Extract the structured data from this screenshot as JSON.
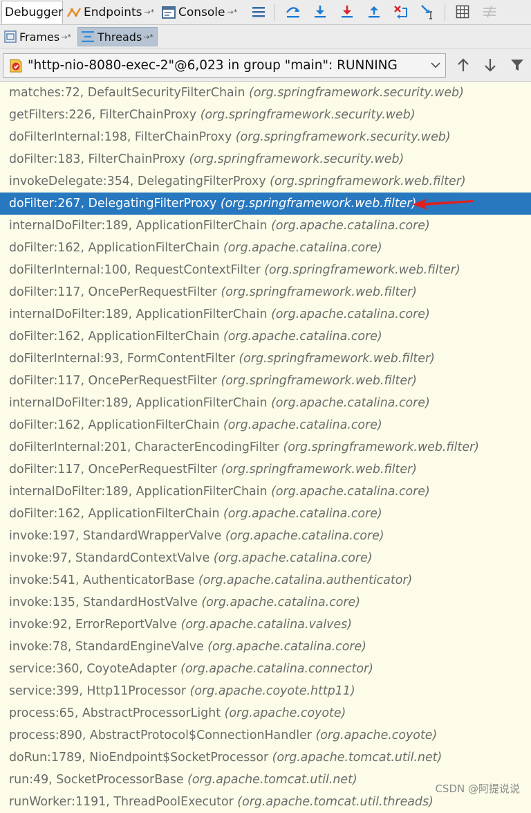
{
  "toolbar": {
    "tabs": [
      {
        "label": "Debugger"
      },
      {
        "label": "Endpoints"
      },
      {
        "label": "Console"
      }
    ],
    "pin_glyph": "→*"
  },
  "subtabs": [
    {
      "label": "Frames"
    },
    {
      "label": "Threads"
    }
  ],
  "thread_selector": {
    "value": "\"http-nio-8080-exec-2\"@6,023 in group \"main\": RUNNING"
  },
  "frames": [
    {
      "method": "matches:72, DefaultSecurityFilterChain",
      "package": "(org.springframework.security.web)"
    },
    {
      "method": "getFilters:226, FilterChainProxy",
      "package": "(org.springframework.security.web)"
    },
    {
      "method": "doFilterInternal:198, FilterChainProxy",
      "package": "(org.springframework.security.web)"
    },
    {
      "method": "doFilter:183, FilterChainProxy",
      "package": "(org.springframework.security.web)"
    },
    {
      "method": "invokeDelegate:354, DelegatingFilterProxy",
      "package": "(org.springframework.web.filter)"
    },
    {
      "method": "doFilter:267, DelegatingFilterProxy",
      "package": "(org.springframework.web.filter)",
      "selected": true
    },
    {
      "method": "internalDoFilter:189, ApplicationFilterChain",
      "package": "(org.apache.catalina.core)"
    },
    {
      "method": "doFilter:162, ApplicationFilterChain",
      "package": "(org.apache.catalina.core)"
    },
    {
      "method": "doFilterInternal:100, RequestContextFilter",
      "package": "(org.springframework.web.filter)"
    },
    {
      "method": "doFilter:117, OncePerRequestFilter",
      "package": "(org.springframework.web.filter)"
    },
    {
      "method": "internalDoFilter:189, ApplicationFilterChain",
      "package": "(org.apache.catalina.core)"
    },
    {
      "method": "doFilter:162, ApplicationFilterChain",
      "package": "(org.apache.catalina.core)"
    },
    {
      "method": "doFilterInternal:93, FormContentFilter",
      "package": "(org.springframework.web.filter)"
    },
    {
      "method": "doFilter:117, OncePerRequestFilter",
      "package": "(org.springframework.web.filter)"
    },
    {
      "method": "internalDoFilter:189, ApplicationFilterChain",
      "package": "(org.apache.catalina.core)"
    },
    {
      "method": "doFilter:162, ApplicationFilterChain",
      "package": "(org.apache.catalina.core)"
    },
    {
      "method": "doFilterInternal:201, CharacterEncodingFilter",
      "package": "(org.springframework.web.filter)"
    },
    {
      "method": "doFilter:117, OncePerRequestFilter",
      "package": "(org.springframework.web.filter)"
    },
    {
      "method": "internalDoFilter:189, ApplicationFilterChain",
      "package": "(org.apache.catalina.core)"
    },
    {
      "method": "doFilter:162, ApplicationFilterChain",
      "package": "(org.apache.catalina.core)"
    },
    {
      "method": "invoke:197, StandardWrapperValve",
      "package": "(org.apache.catalina.core)"
    },
    {
      "method": "invoke:97, StandardContextValve",
      "package": "(org.apache.catalina.core)"
    },
    {
      "method": "invoke:541, AuthenticatorBase",
      "package": "(org.apache.catalina.authenticator)"
    },
    {
      "method": "invoke:135, StandardHostValve",
      "package": "(org.apache.catalina.core)"
    },
    {
      "method": "invoke:92, ErrorReportValve",
      "package": "(org.apache.catalina.valves)"
    },
    {
      "method": "invoke:78, StandardEngineValve",
      "package": "(org.apache.catalina.core)"
    },
    {
      "method": "service:360, CoyoteAdapter",
      "package": "(org.apache.catalina.connector)"
    },
    {
      "method": "service:399, Http11Processor",
      "package": "(org.apache.coyote.http11)"
    },
    {
      "method": "process:65, AbstractProcessorLight",
      "package": "(org.apache.coyote)"
    },
    {
      "method": "process:890, AbstractProtocol$ConnectionHandler",
      "package": "(org.apache.coyote)"
    },
    {
      "method": "doRun:1789, NioEndpoint$SocketProcessor",
      "package": "(org.apache.tomcat.util.net)"
    },
    {
      "method": "run:49, SocketProcessorBase",
      "package": "(org.apache.tomcat.util.net)"
    },
    {
      "method": "runWorker:1191, ThreadPoolExecutor",
      "package": "(org.apache.tomcat.util.threads)"
    }
  ],
  "watermark": "CSDN @阿提说说",
  "colors": {
    "selection": "#2878c0",
    "arrow": "#e02020",
    "frame_bg": "#fcfce8",
    "step_icon_blue": "#1e7bd6",
    "step_icon_red": "#d9232e"
  }
}
